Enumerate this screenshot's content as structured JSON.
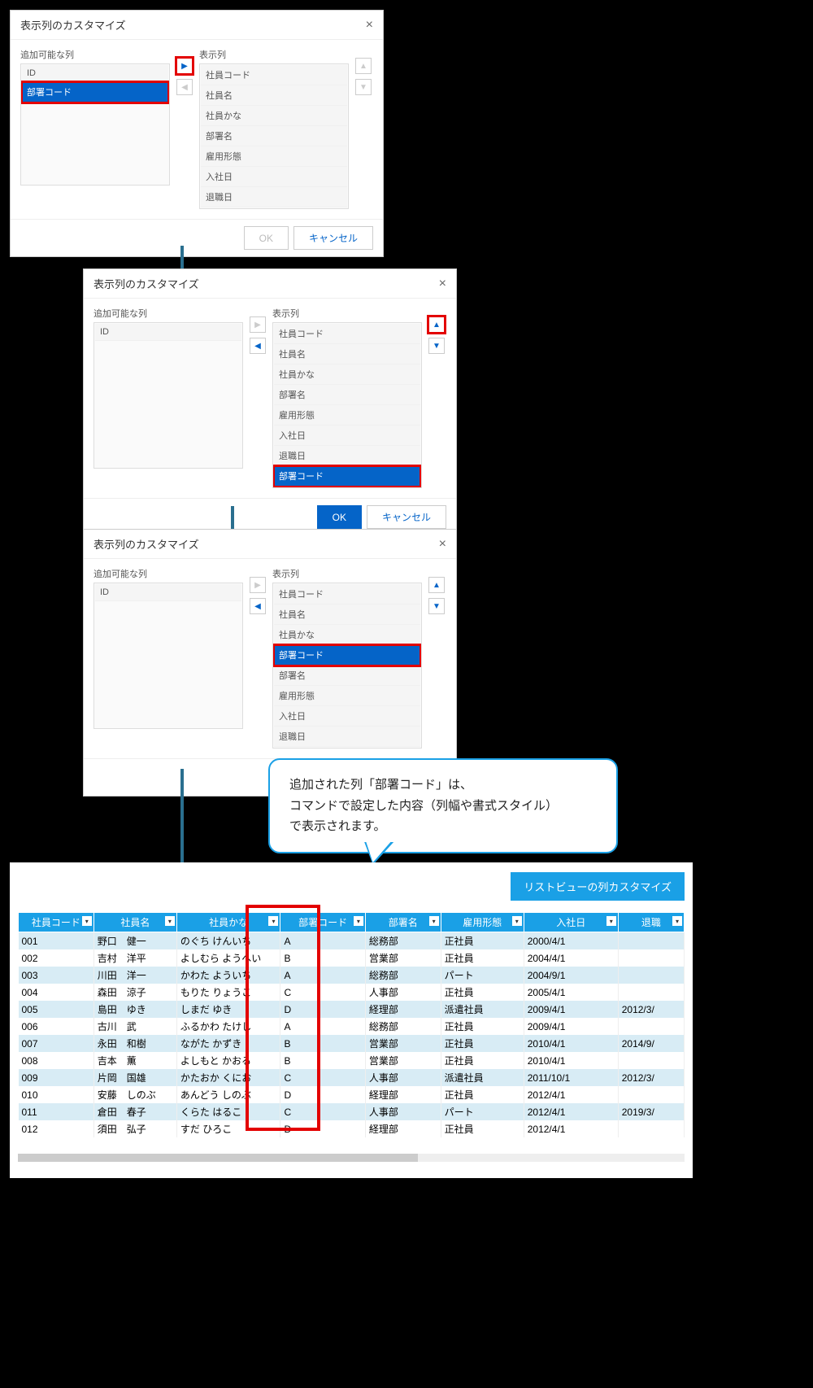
{
  "dialog": {
    "title": "表示列のカスタマイズ",
    "available_label": "追加可能な列",
    "displayed_label": "表示列",
    "ok": "OK",
    "cancel": "キャンセル"
  },
  "d1": {
    "available": [
      "ID",
      "部署コード"
    ],
    "available_selected": 1,
    "displayed": [
      "社員コード",
      "社員名",
      "社員かな",
      "部署名",
      "雇用形態",
      "入社日",
      "退職日"
    ]
  },
  "d2": {
    "available": [
      "ID"
    ],
    "displayed": [
      "社員コード",
      "社員名",
      "社員かな",
      "部署名",
      "雇用形態",
      "入社日",
      "退職日",
      "部署コード"
    ],
    "displayed_selected": 7
  },
  "d3": {
    "available": [
      "ID"
    ],
    "displayed": [
      "社員コード",
      "社員名",
      "社員かな",
      "部署コード",
      "部署名",
      "雇用形態",
      "入社日",
      "退職日"
    ],
    "displayed_selected": 3
  },
  "callout": {
    "line1": "追加された列「部署コード」は、",
    "line2": "コマンドで設定した内容（列幅や書式スタイル）",
    "line3": "で表示されます。"
  },
  "result": {
    "customize_btn": "リストビューの列カスタマイズ",
    "headers": [
      "社員コード",
      "社員名",
      "社員かな",
      "部署コード",
      "部署名",
      "雇用形態",
      "入社日",
      "退職"
    ],
    "rows": [
      [
        "001",
        "野口　健一",
        "のぐち けんいち",
        "A",
        "総務部",
        "正社員",
        "2000/4/1",
        ""
      ],
      [
        "002",
        "吉村　洋平",
        "よしむら ようへい",
        "B",
        "営業部",
        "正社員",
        "2004/4/1",
        ""
      ],
      [
        "003",
        "川田　洋一",
        "かわた よういち",
        "A",
        "総務部",
        "パート",
        "2004/9/1",
        ""
      ],
      [
        "004",
        "森田　涼子",
        "もりた りょうこ",
        "C",
        "人事部",
        "正社員",
        "2005/4/1",
        ""
      ],
      [
        "005",
        "島田　ゆき",
        "しまだ ゆき",
        "D",
        "経理部",
        "派遣社員",
        "2009/4/1",
        "2012/3/"
      ],
      [
        "006",
        "古川　武",
        "ふるかわ たけし",
        "A",
        "総務部",
        "正社員",
        "2009/4/1",
        ""
      ],
      [
        "007",
        "永田　和樹",
        "ながた かずき",
        "B",
        "営業部",
        "正社員",
        "2010/4/1",
        "2014/9/"
      ],
      [
        "008",
        "吉本　薫",
        "よしもと かおる",
        "B",
        "営業部",
        "正社員",
        "2010/4/1",
        ""
      ],
      [
        "009",
        "片岡　国雄",
        "かたおか くにお",
        "C",
        "人事部",
        "派遣社員",
        "2011/10/1",
        "2012/3/"
      ],
      [
        "010",
        "安藤　しのぶ",
        "あんどう しのぶ",
        "D",
        "経理部",
        "正社員",
        "2012/4/1",
        ""
      ],
      [
        "011",
        "倉田　春子",
        "くらた はるこ",
        "C",
        "人事部",
        "パート",
        "2012/4/1",
        "2019/3/"
      ],
      [
        "012",
        "須田　弘子",
        "すだ ひろこ",
        "D",
        "経理部",
        "正社員",
        "2012/4/1",
        ""
      ]
    ]
  }
}
